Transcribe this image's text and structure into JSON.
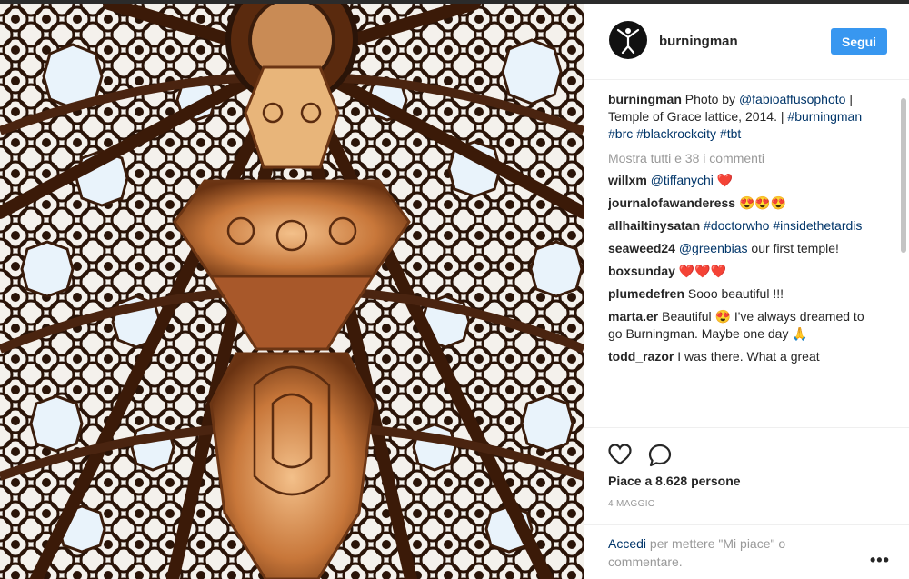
{
  "post": {
    "username": "burningman",
    "follow_label": "Segui",
    "photo_alt": "Temple of Grace lattice dome interior",
    "avatar_icon": "burning-man-logo-icon",
    "colors": {
      "accent": "#3897f0",
      "link": "#003569",
      "muted": "#999999"
    }
  },
  "caption": {
    "username": "burningman",
    "text_1": "Photo by ",
    "mention": "@fabioaffusophoto",
    "text_2": " | Temple of Grace lattice, 2014. | ",
    "hashtags_a": "#burningman #brc",
    "hashtags_b": "#blackrockcity #tbt"
  },
  "comments": {
    "more_label": "Mostra tutti e 38 i commenti",
    "items": [
      {
        "user": "willxm",
        "link": "@tiffanychi",
        "text": "",
        "emoji": "❤️"
      },
      {
        "user": "journalofawanderess",
        "link": "",
        "text": "",
        "emoji": "😍😍😍"
      },
      {
        "user": "allhailtinysatan",
        "link": "#doctorwho #insidethetardis",
        "text": "",
        "emoji": ""
      },
      {
        "user": "seaweed24",
        "link": "@greenbias",
        "text": " our first temple!",
        "emoji": ""
      },
      {
        "user": "boxsunday",
        "link": "",
        "text": "",
        "emoji": "❤️❤️❤️"
      },
      {
        "user": "plumedefren",
        "link": "",
        "text": "Sooo beautiful !!!",
        "emoji": ""
      },
      {
        "user": "marta.er",
        "link": "",
        "text_a": "Beautiful",
        "emoji_a": "😍",
        "text": " I've always dreamed to go Burningman. Maybe one day",
        "emoji": "🙏"
      },
      {
        "user": "todd_razor",
        "link": "",
        "text": "I was there. What a great",
        "emoji": ""
      }
    ]
  },
  "actions": {
    "like_icon": "heart-outline-icon",
    "comment_icon": "comment-bubble-icon",
    "likes_label": "Piace a 8.628 persone",
    "date_label": "4 MAGGIO"
  },
  "footer": {
    "login_label": "Accedi",
    "login_rest": "per mettere \"Mi piace\" o commentare.",
    "more_icon": "more-options-icon",
    "more_glyph": "•••"
  }
}
